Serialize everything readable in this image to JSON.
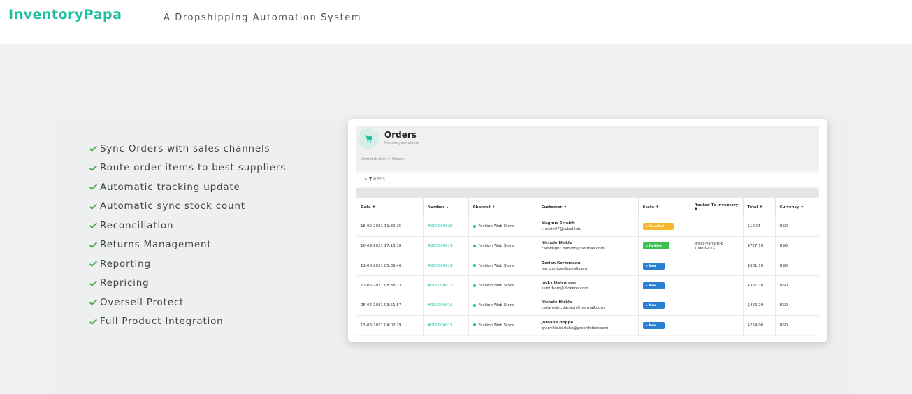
{
  "header": {
    "brand": "InventoryPapa",
    "tagline": "A Dropshipping Automation System"
  },
  "features": [
    "Sync Orders with sales channels",
    "Route order items to best suppliers",
    "Automatic tracking update",
    "Automatic sync stock count",
    "Reconciliation",
    "Returns Management",
    "Reporting",
    "Repricing",
    "Oversell Protect",
    "Full Product Integration"
  ],
  "orders_panel": {
    "title": "Orders",
    "subtitle": "Process your orders",
    "breadcrumb": "Administration  >  Orders",
    "filters_label": "Filters",
    "columns": [
      "Date ♦",
      "Number ⌄",
      "Channel ♦",
      "Customer ♦",
      "State ♦",
      "Routed To Inventory ♦",
      "Total ♦",
      "Currency ♦"
    ],
    "rows": [
      {
        "date": "18-09-2021 11:32:25",
        "number": "#000000020",
        "channel": "Fashion Web Store",
        "customer_name": "Magnus Streich",
        "customer_email": "chelsie97@robel.info",
        "state": "Cancelled",
        "routed": "",
        "total": "$10.05",
        "currency": "USD"
      },
      {
        "date": "16-09-2021 17:16:18",
        "number": "#000000019",
        "channel": "Fashion Web Store",
        "customer_name": "Nichole Hickle",
        "customer_email": "cartwright.damion@hotmail.com",
        "state": "Fulfilled",
        "routed": "dress-variant-8 : inventory1",
        "total": "$727.10",
        "currency": "USD"
      },
      {
        "date": "11-06-2021 05:36:46",
        "number": "#000000018",
        "channel": "Fashion Web Store",
        "customer_name": "Dorian Kertzmann",
        "customer_email": "fae.trantow@gmail.com",
        "state": "New",
        "routed": "",
        "total": "$381.10",
        "currency": "USD"
      },
      {
        "date": "13-05-2021 08:38:23",
        "number": "#000000017",
        "channel": "Fashion Web Store",
        "customer_name": "Jacky Halvorson",
        "customer_email": "xsmitham@dickens.com",
        "state": "New",
        "routed": "",
        "total": "$321.18",
        "currency": "USD"
      },
      {
        "date": "05-04-2021 03:51:57",
        "number": "#000000016",
        "channel": "Fashion Web Store",
        "customer_name": "Nichole Hickle",
        "customer_email": "cartwright.damion@hotmail.com",
        "state": "New",
        "routed": "",
        "total": "$466.29",
        "currency": "USD"
      },
      {
        "date": "13-03-2021 04:02:29",
        "number": "#000000015",
        "channel": "Fashion Web Store",
        "customer_name": "Jordane Hoppe",
        "customer_email": "granville.kerluke@greenfelder.com",
        "state": "New",
        "routed": "",
        "total": "$254.08",
        "currency": "USD"
      }
    ]
  },
  "colors": {
    "brand": "#1fbf9f",
    "check": "#4caf50",
    "cancelled": "#f4b830",
    "fulfilled": "#3bbf4f",
    "new": "#2a7fd1"
  }
}
